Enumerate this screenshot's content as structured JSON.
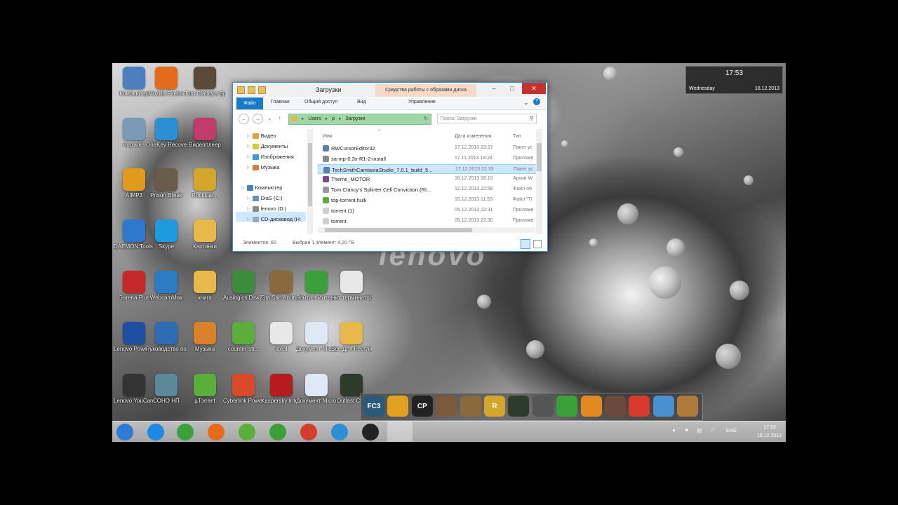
{
  "clock": {
    "time": "17:53",
    "day": "Wednesday",
    "date": "18.12.2013"
  },
  "brand_text": "lenovo",
  "desktop_icons": [
    {
      "label": "Компьютер",
      "icon": "computer-icon",
      "color": "#4a7fc0"
    },
    {
      "label": "Mozilla Firefox",
      "icon": "firefox-icon",
      "color": "#e56a1a"
    },
    {
      "label": "Tom Clancy's Splinter Cel...",
      "icon": "game-icon",
      "color": "#5a4a3a"
    },
    {
      "label": "Корзина",
      "icon": "recycle-bin-icon",
      "color": "#7a9ab8"
    },
    {
      "label": "OneKey Recovery",
      "icon": "recovery-icon",
      "color": "#2b8fd6"
    },
    {
      "label": "Видеоплеер",
      "icon": "video-icon",
      "color": "#c23b6b"
    },
    {
      "label": "AIMP3",
      "icon": "aimp-icon",
      "color": "#e29a1c"
    },
    {
      "label": "Prison Break",
      "icon": "game-icon",
      "color": "#6b5b4b"
    },
    {
      "label": "Rockstar...",
      "icon": "rockstar-icon",
      "color": "#d4a72c"
    },
    {
      "label": "DAEMON Tools Lite",
      "icon": "daemon-icon",
      "color": "#2f78d0"
    },
    {
      "label": "Skype",
      "icon": "skype-icon",
      "color": "#1d9be0"
    },
    {
      "label": "Картинки",
      "icon": "folder-icon",
      "color": "#e6b94a"
    },
    {
      "label": "Garena Plus",
      "icon": "garena-icon",
      "color": "#c62828"
    },
    {
      "label": "WebcamMax",
      "icon": "webcam-icon",
      "color": "#2a7cc7"
    },
    {
      "label": "книга",
      "icon": "folder-icon",
      "color": "#e6b94a"
    },
    {
      "label": "Auslogics DiskDefrag",
      "icon": "defrag-icon",
      "color": "#3b8d3b"
    },
    {
      "label": "Gta San Andreas",
      "icon": "gta-icon",
      "color": "#8a6a3a"
    },
    {
      "label": "Войти в Интернет",
      "icon": "internet-icon",
      "color": "#3aa03a"
    },
    {
      "label": "Чит терминатор",
      "icon": "file-icon",
      "color": "#e8e8e8"
    },
    {
      "label": "Lenovo PowerDVD10",
      "icon": "powerdvd-icon",
      "color": "#1f4fa3"
    },
    {
      "label": "Руководство пользоват...",
      "icon": "lenovo-icon",
      "color": "#2d6db5"
    },
    {
      "label": "Музыка",
      "icon": "folder-music-icon",
      "color": "#d9822b"
    },
    {
      "label": "counter-str...",
      "icon": "utorrent-icon",
      "color": "#5cae3a"
    },
    {
      "label": "ideal",
      "icon": "file-icon",
      "color": "#e8e8e8"
    },
    {
      "label": "Документ Microsoft ...",
      "icon": "word-doc-icon",
      "color": "#dfe8f5"
    },
    {
      "label": "Все Для Рестлинга",
      "icon": "folder-icon",
      "color": "#e6b94a"
    },
    {
      "label": "Lenovo YouCam",
      "icon": "youcam-icon",
      "color": "#333333"
    },
    {
      "label": "СОНО НП",
      "icon": "app-icon",
      "color": "#5a8a9a"
    },
    {
      "label": "µTorrent",
      "icon": "utorrent-icon",
      "color": "#5cae3a"
    },
    {
      "label": "Cyberlink Power2Go",
      "icon": "power2go-icon",
      "color": "#d94a2b"
    },
    {
      "label": "Kaspersky Internet Se...",
      "icon": "kaspersky-icon",
      "color": "#b71c1c"
    },
    {
      "label": "Документ Microsoft ...",
      "icon": "word-doc-icon",
      "color": "#dfe8f5"
    },
    {
      "label": "Outlast Cr...",
      "icon": "game-icon",
      "color": "#2c3b2c"
    }
  ],
  "explorer": {
    "title": "Загрузки",
    "context_tab": "Средства работы с образами диска",
    "ribbon_tabs": [
      "Файл",
      "Главная",
      "Общий доступ",
      "Вид",
      "Управление"
    ],
    "path": [
      "Users",
      "p",
      "Загрузки"
    ],
    "search_placeholder": "Поиск: Загрузки",
    "nav_items": [
      {
        "label": "Видео",
        "icon": "video-folder-icon",
        "color": "#e0a33b"
      },
      {
        "label": "Документы",
        "icon": "documents-folder-icon",
        "color": "#e0c23b"
      },
      {
        "label": "Изображения",
        "icon": "pictures-folder-icon",
        "color": "#3b9ae0"
      },
      {
        "label": "Музыка",
        "icon": "music-folder-icon",
        "color": "#e07a3b"
      },
      {
        "label": "Компьютер",
        "icon": "computer-icon",
        "color": "#4a7fc0"
      },
      {
        "label": "DiaS (C:)",
        "icon": "drive-icon",
        "color": "#6b8fb8"
      },
      {
        "label": "lenovo (D:)",
        "icon": "drive-icon",
        "color": "#8a8a8a"
      },
      {
        "label": "CD-дисковод (H:",
        "icon": "cd-drive-icon",
        "color": "#9aaac0"
      }
    ],
    "columns": {
      "name": "Имя",
      "date": "Дата изменения",
      "type": "Тип"
    },
    "files": [
      {
        "name": "RWCursorEditor32",
        "date": "17.12.2013 23:27",
        "type": "Пакет ус",
        "icon": "installer-icon",
        "color": "#5a7fb0",
        "selected": false
      },
      {
        "name": "sa-mp-0.3x-R1-2-install",
        "date": "17.11.2013 19:24",
        "type": "Приложе",
        "icon": "app-icon",
        "color": "#8a8a8a",
        "selected": false
      },
      {
        "name": "TechSmithCamtasiaStudio_7.0.1_build_5...",
        "date": "17.12.2013 22:33",
        "type": "Пакет ус",
        "icon": "installer-icon",
        "color": "#5a7fb0",
        "selected": true
      },
      {
        "name": "Theme_MOTOR",
        "date": "16.12.2013 18:10",
        "type": "Архив W",
        "icon": "archive-icon",
        "color": "#7a4a8a",
        "selected": false
      },
      {
        "name": "Tom Clancy's Splinter Cell Conviction.(RI...",
        "date": "12.12.2013 22:56",
        "type": "Файл об",
        "icon": "disc-image-icon",
        "color": "#9a9a9a",
        "selected": false
      },
      {
        "name": "top-torrent.hulk",
        "date": "15.12.2013 11:53",
        "type": "Файл \"TI",
        "icon": "utorrent-icon",
        "color": "#5cae3a",
        "selected": false
      },
      {
        "name": "torrent (1)",
        "date": "05.12.2013 22:31",
        "type": "Приложе",
        "icon": "app-icon",
        "color": "#cfcfcf",
        "selected": false
      },
      {
        "name": "torrent",
        "date": "05.12.2013 22:30",
        "type": "Приложе",
        "icon": "app-icon",
        "color": "#cfcfcf",
        "selected": false
      }
    ],
    "status_count": "Элементов: 60",
    "status_selected": "Выбран 1 элемент: 4,20 ГБ"
  },
  "dock_items": [
    {
      "label": "FC3",
      "icon": "farcry3-icon",
      "color": "#2a5a7a"
    },
    {
      "label": "",
      "icon": "subway-surfers-icon",
      "color": "#e0a020"
    },
    {
      "label": "CP",
      "icon": "cp-icon",
      "color": "#222222"
    },
    {
      "label": "",
      "icon": "game-face-icon",
      "color": "#7a5a3a"
    },
    {
      "label": "",
      "icon": "gta-icon",
      "color": "#8a6a3a"
    },
    {
      "label": "R",
      "icon": "rockstar-icon",
      "color": "#d4a72c"
    },
    {
      "label": "",
      "icon": "splinter-cell-icon",
      "color": "#2c3b2c"
    },
    {
      "label": "",
      "icon": "assassin-icon",
      "color": "#555555"
    },
    {
      "label": "",
      "icon": "internet-icon",
      "color": "#3aa03a"
    },
    {
      "label": "",
      "icon": "tv-icon",
      "color": "#e08a20"
    },
    {
      "label": "",
      "icon": "game-face-icon",
      "color": "#6a4a3a"
    },
    {
      "label": "",
      "icon": "chrome-icon",
      "color": "#d83a2e"
    },
    {
      "label": "",
      "icon": "app-icon",
      "color": "#4a90d0"
    },
    {
      "label": "",
      "icon": "game-face-icon",
      "color": "#b07a3a"
    }
  ],
  "taskbar_items": [
    {
      "icon": "start-icon",
      "color": "#2d7bd6"
    },
    {
      "icon": "internet-explorer-icon",
      "color": "#1e88e5"
    },
    {
      "icon": "mail-at-icon",
      "color": "#3aa03a"
    },
    {
      "icon": "firefox-icon",
      "color": "#e56a1a"
    },
    {
      "icon": "utorrent-icon",
      "color": "#5cae3a"
    },
    {
      "icon": "internet-icon",
      "color": "#3aa03a"
    },
    {
      "icon": "chrome-icon",
      "color": "#d83a2e"
    },
    {
      "icon": "recovery-icon",
      "color": "#2b8fd6"
    },
    {
      "icon": "app-icon",
      "color": "#222222"
    },
    {
      "icon": "explorer-icon",
      "color": "#e6b94a"
    }
  ],
  "tray": {
    "lang": "ENG",
    "time": "17:53",
    "date": "18.12.2013"
  }
}
